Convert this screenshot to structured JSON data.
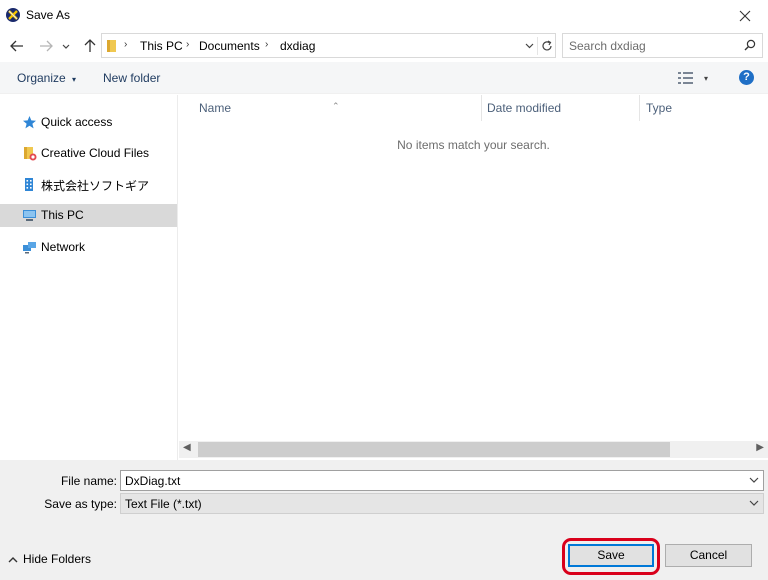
{
  "window": {
    "title": "Save As",
    "close_icon": "close-icon"
  },
  "address": {
    "crumbs": [
      "This PC",
      "Documents",
      "dxdiag"
    ]
  },
  "search": {
    "placeholder": "Search dxdiag"
  },
  "commands": {
    "organize": "Organize",
    "new_folder": "New folder",
    "help": "?"
  },
  "sidebar": {
    "items": [
      {
        "label": "Quick access",
        "icon": "star-icon"
      },
      {
        "label": "Creative Cloud Files",
        "icon": "cloud-folder-icon"
      },
      {
        "label": "株式会社ソフトギア",
        "icon": "building-icon"
      },
      {
        "label": "This PC",
        "icon": "computer-icon",
        "selected": true
      },
      {
        "label": "Network",
        "icon": "network-icon"
      }
    ]
  },
  "filelist": {
    "columns": [
      "Name",
      "Date modified",
      "Type"
    ],
    "empty_message": "No items match your search."
  },
  "form": {
    "filename_label": "File name:",
    "filename_value": "DxDiag.txt",
    "filetype_label": "Save as type:",
    "filetype_value": "Text File (*.txt)"
  },
  "footer": {
    "hide_folders": "Hide Folders",
    "save": "Save",
    "cancel": "Cancel"
  },
  "colors": {
    "accent": "#0078d7",
    "highlight": "#d9001b",
    "help": "#1f6fc6"
  }
}
